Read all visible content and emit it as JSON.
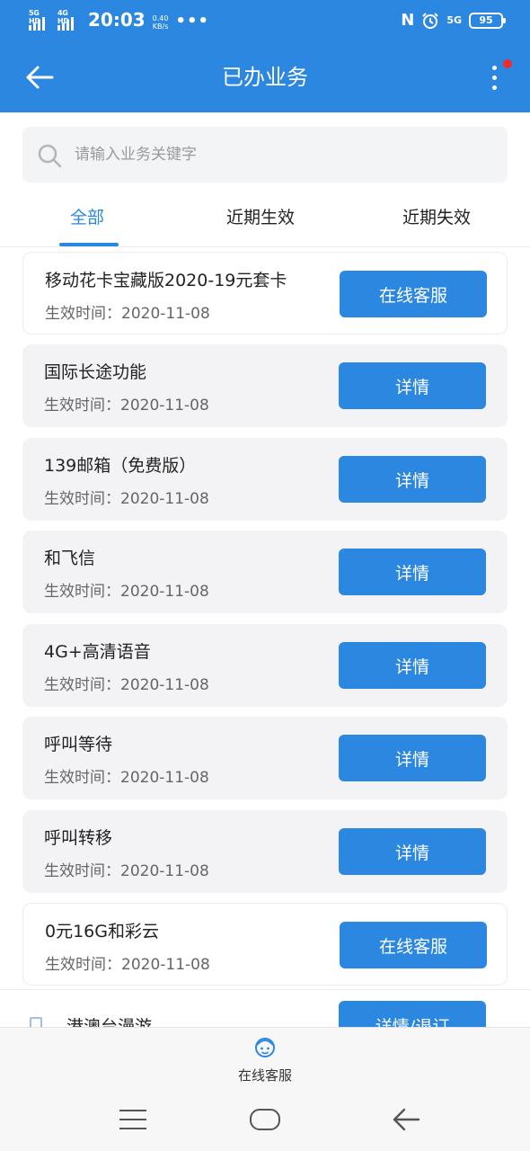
{
  "status_bar": {
    "sim1": "5G HD",
    "sim2": "4G HD",
    "time": "20:03",
    "speed_value": "0.40",
    "speed_unit": "KB/s",
    "more": "•••",
    "nfc": "N",
    "network": "5G",
    "battery": "95"
  },
  "header": {
    "title": "已办业务"
  },
  "search": {
    "placeholder": "请输入业务关键字"
  },
  "tabs": [
    {
      "label": "全部"
    },
    {
      "label": "近期生效"
    },
    {
      "label": "近期失效"
    }
  ],
  "items": [
    {
      "name": "移动花卡宝藏版2020-19元套卡",
      "date": "生效时间：2020-11-08",
      "button": "在线客服"
    },
    {
      "name": "国际长途功能",
      "date": "生效时间：2020-11-08",
      "button": "详情"
    },
    {
      "name": "139邮箱（免费版）",
      "date": "生效时间：2020-11-08",
      "button": "详情"
    },
    {
      "name": "和飞信",
      "date": "生效时间：2020-11-08",
      "button": "详情"
    },
    {
      "name": "4G+高清语音",
      "date": "生效时间：2020-11-08",
      "button": "详情"
    },
    {
      "name": "呼叫等待",
      "date": "生效时间：2020-11-08",
      "button": "详情"
    },
    {
      "name": "呼叫转移",
      "date": "生效时间：2020-11-08",
      "button": "详情"
    },
    {
      "name": "0元16G和彩云",
      "date": "生效时间：2020-11-08",
      "button": "在线客服"
    }
  ],
  "partial_item": {
    "name": "港澳台漫游",
    "button": "详情/退订"
  },
  "bottom_bar": {
    "service_label": "在线客服"
  },
  "colors": {
    "primary": "#2b87e0",
    "badge": "#ef2d2d",
    "card_gray": "#f3f3f5"
  }
}
